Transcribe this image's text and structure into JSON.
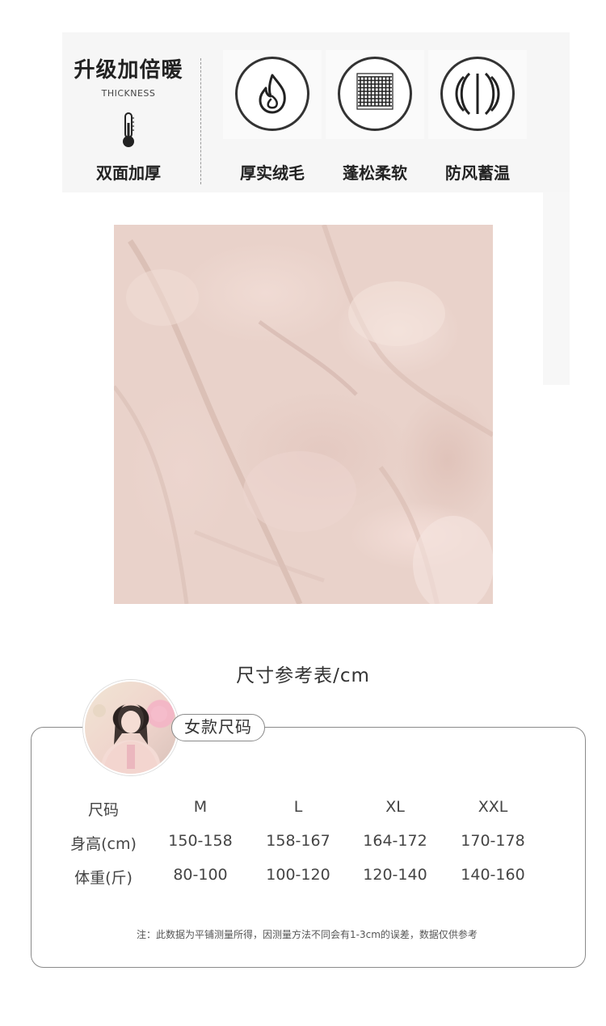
{
  "upgrade": {
    "title": "升级加倍暖",
    "subtitle": "THICKNESS",
    "label": "双面加厚",
    "icon": "thermometer-icon"
  },
  "features": [
    {
      "icon": "flame-icon",
      "label": "厚实绒毛"
    },
    {
      "icon": "fabric-grid-icon",
      "label": "蓬松柔软"
    },
    {
      "icon": "windproof-icon",
      "label": "防风蓄温"
    }
  ],
  "size_chart": {
    "heading": "尺寸参考表/cm",
    "tag": "女款尺码",
    "headers": [
      "尺码",
      "M",
      "L",
      "XL",
      "XXL"
    ],
    "rows": [
      [
        "身高(cm)",
        "150-158",
        "158-167",
        "164-172",
        "170-178"
      ],
      [
        "体重(斤)",
        "80-100",
        "100-120",
        "120-140",
        "140-160"
      ]
    ],
    "note": "注：此数据为平铺测量所得，因测量方法不同会有1-3cm的误差，数据仅供参考"
  },
  "colors": {
    "fabric": "#e9d2ca",
    "border": "#8a8a8a",
    "text": "#333333"
  }
}
